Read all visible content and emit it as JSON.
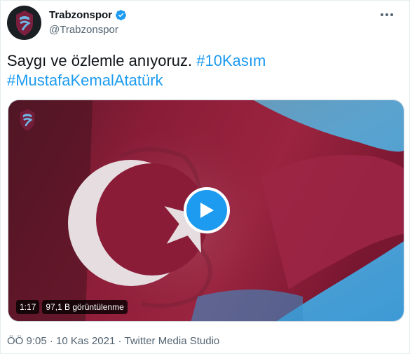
{
  "author": {
    "name": "Trabzonspor",
    "handle": "@Trabzonspor",
    "verified_icon": "verified-badge-icon",
    "avatar_icon": "club-crest-icon"
  },
  "tweet": {
    "text": "Saygı ve özlemle anıyoruz. ",
    "hashtag1": "#10Kasım",
    "hashtag2": "#MustafaKemalAtatürk"
  },
  "media": {
    "duration": "1:17",
    "views": "97,1 B görüntülenme",
    "play_icon": "play-icon"
  },
  "meta": {
    "time": "ÖÖ 9:05",
    "sep1": " · ",
    "date": "10 Kas 2021",
    "sep2": " · ",
    "source": "Twitter Media Studio"
  },
  "colors": {
    "accent": "#1d9bf0",
    "flag_red": "#8a1c37",
    "sky": "#4aa6d8"
  }
}
